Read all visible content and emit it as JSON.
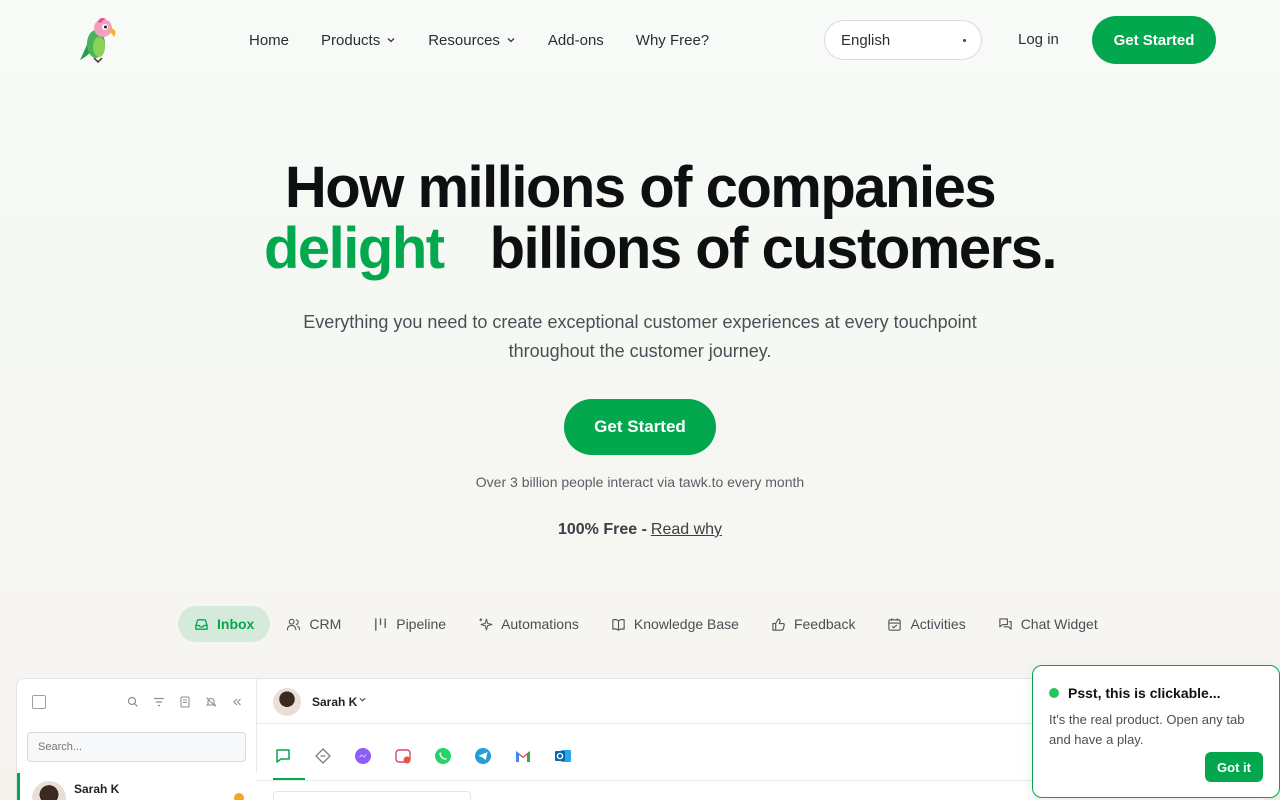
{
  "header": {
    "logo_alt": "tawk.to",
    "nav": [
      {
        "label": "Home",
        "has_menu": false
      },
      {
        "label": "Products",
        "has_menu": true
      },
      {
        "label": "Resources",
        "has_menu": true
      },
      {
        "label": "Add-ons",
        "has_menu": false
      },
      {
        "label": "Why Free?",
        "has_menu": false
      }
    ],
    "language": "English",
    "login_label": "Log in",
    "cta_label": "Get Started"
  },
  "hero": {
    "title_line1": "How millions of companies",
    "title_highlight": "delight",
    "title_line2_rest": "billions of customers.",
    "subtitle": "Everything you need to create exceptional customer experiences at every touchpoint throughout the customer journey.",
    "cta_label": "Get Started",
    "note": "Over 3 billion people interact via tawk.to every month",
    "free_bold": "100% Free -",
    "free_link": "Read why"
  },
  "tabs": [
    {
      "label": "Inbox",
      "icon": "inbox-icon",
      "active": true
    },
    {
      "label": "CRM",
      "icon": "users-icon",
      "active": false
    },
    {
      "label": "Pipeline",
      "icon": "pipeline-icon",
      "active": false
    },
    {
      "label": "Automations",
      "icon": "sparkle-icon",
      "active": false
    },
    {
      "label": "Knowledge Base",
      "icon": "book-icon",
      "active": false
    },
    {
      "label": "Feedback",
      "icon": "thumbs-up-icon",
      "active": false
    },
    {
      "label": "Activities",
      "icon": "calendar-icon",
      "active": false
    },
    {
      "label": "Chat Widget",
      "icon": "chat-icon",
      "active": false
    }
  ],
  "app": {
    "search_placeholder": "Search...",
    "conversation_name": "Sarah K",
    "contact_name": "Sarah K",
    "channels": [
      "chat-icon",
      "ticket-icon",
      "messenger-icon",
      "instagram-icon",
      "whatsapp-icon",
      "telegram-icon",
      "gmail-icon",
      "outlook-icon"
    ]
  },
  "popup": {
    "title": "Psst, this is clickable...",
    "body": "It's the real product. Open any tab and have a play.",
    "button_label": "Got it"
  },
  "colors": {
    "brand_green": "#03a84e",
    "active_tab_bg": "#d6eadc"
  }
}
